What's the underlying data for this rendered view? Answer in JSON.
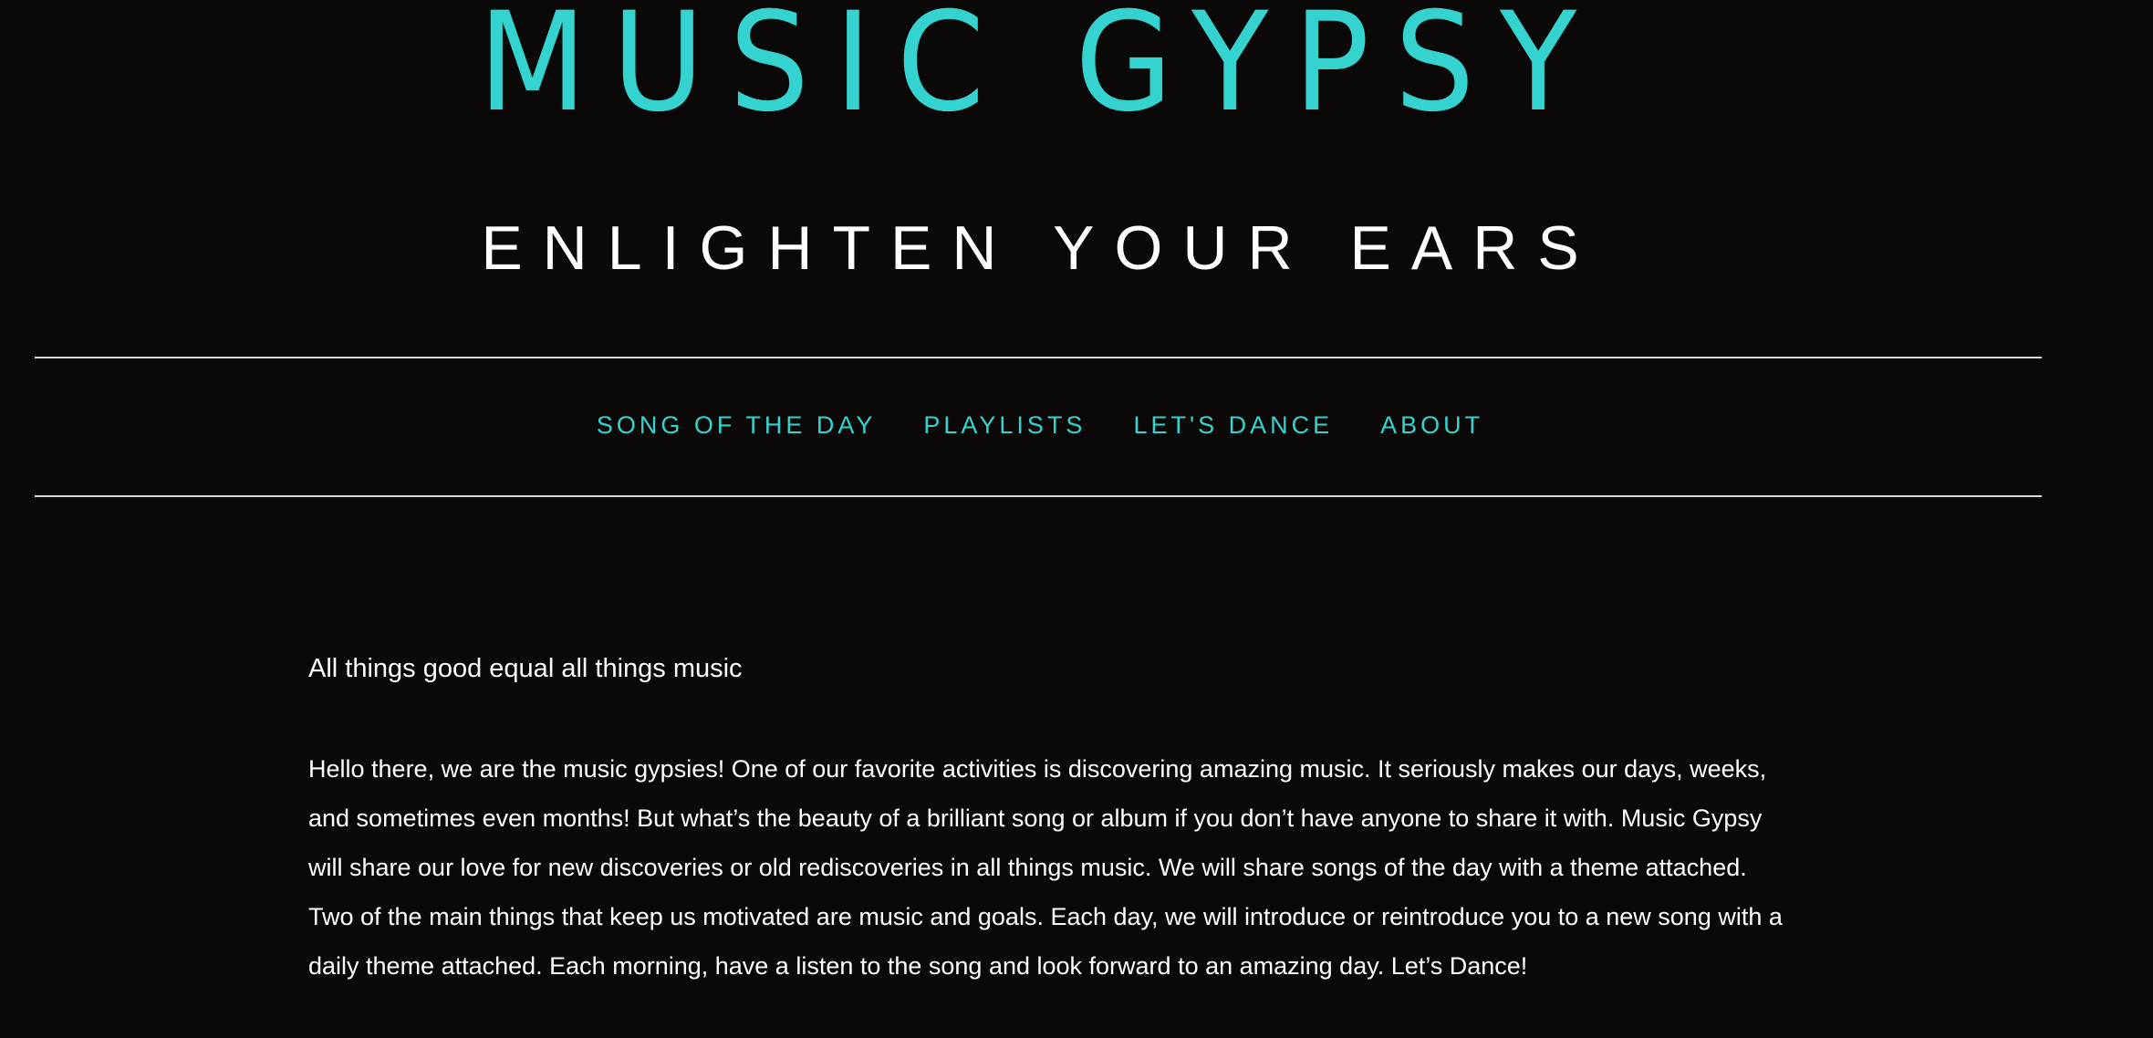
{
  "header": {
    "site_title": "MUSIC GYPSY",
    "tagline": "ENLIGHTEN YOUR EARS"
  },
  "nav": {
    "items": [
      {
        "label": "SONG OF THE DAY"
      },
      {
        "label": "PLAYLISTS"
      },
      {
        "label": "LET'S DANCE"
      },
      {
        "label": "ABOUT"
      }
    ]
  },
  "main": {
    "lead": "All things good equal all things music",
    "body": "Hello there, we are the music gypsies! One of our favorite activities is discovering amazing music. It seriously makes our days, weeks, and sometimes even months! But what’s the beauty of a brilliant song or album if you don’t have anyone to share it with. Music Gypsy will share our love for new discoveries or old rediscoveries in all things music. We will share songs of the day with a theme attached. Two of the main things that keep us motivated are music and goals. Each day, we will introduce or reintroduce you to a new song with a daily theme attached. Each morning, have a listen to the song and look forward to an amazing day.  Let’s Dance!"
  },
  "colors": {
    "background": "#0b0908",
    "accent": "#35d3d0",
    "text": "#ffffff",
    "divider": "#d9d9d9"
  }
}
